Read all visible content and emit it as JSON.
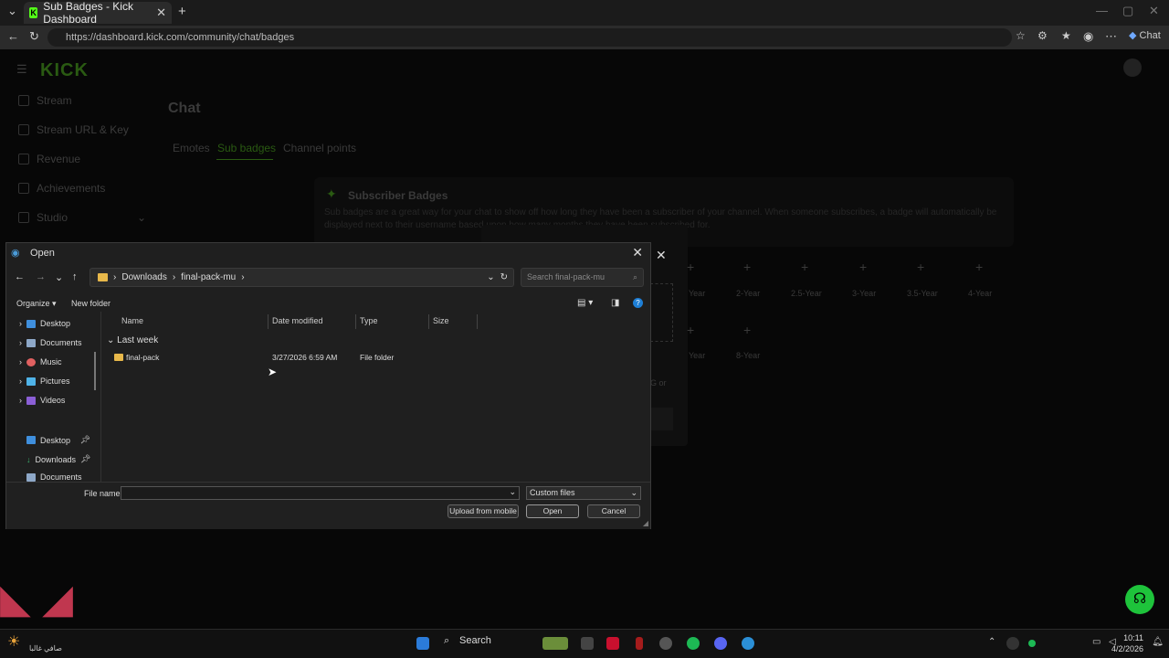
{
  "browser": {
    "tab_title": "Sub Badges - Kick Dashboard",
    "url": "https://dashboard.kick.com/community/chat/badges",
    "chat_label": "Chat"
  },
  "sidebar": {
    "logo": "KICK",
    "items": [
      {
        "label": "Stream"
      },
      {
        "label": "Stream URL & Key"
      },
      {
        "label": "Revenue"
      },
      {
        "label": "Achievements"
      },
      {
        "label": "Studio"
      }
    ]
  },
  "main": {
    "title": "Chat",
    "tabs": [
      "Emotes",
      "Sub badges",
      "Channel points"
    ],
    "card_title": "Subscriber Badges",
    "card_desc": "Sub badges are a great way for your chat to show off how long they have been a subscriber of your channel. When someone subscribes, a badge will automatically be displayed next to their username based upon how many months they have been subscribed for.",
    "badges": [
      "2-Year",
      "2.5-Year",
      "3-Year",
      "3.5-Year",
      "4-Year",
      "8-Year"
    ],
    "partial_text": "G or"
  },
  "dialog": {
    "title": "Open",
    "path": [
      "Downloads",
      "final-pack-mu"
    ],
    "search_placeholder": "Search final-pack-mu",
    "organize": "Organize",
    "new_folder": "New folder",
    "nav_tree": [
      "Desktop",
      "Documents",
      "Music",
      "Pictures",
      "Videos"
    ],
    "quick_access": [
      "Desktop",
      "Downloads",
      "Documents"
    ],
    "columns": [
      "Name",
      "Date modified",
      "Type",
      "Size"
    ],
    "group": "Last week",
    "files": [
      {
        "name": "final-pack",
        "date": "3/27/2026 6:59 AM",
        "type": "File folder",
        "size": ""
      }
    ],
    "file_name_label": "File name:",
    "file_name_value": "",
    "file_type": "Custom files",
    "upload_btn": "Upload from mobile",
    "open_btn": "Open",
    "cancel_btn": "Cancel"
  },
  "taskbar": {
    "search": "Search",
    "time": "10:11",
    "date": "4/2/2026",
    "weather_text": "صافي غالبا"
  },
  "colors": {
    "kick_green": "#53fc18",
    "fab_green": "#1ec33b"
  }
}
